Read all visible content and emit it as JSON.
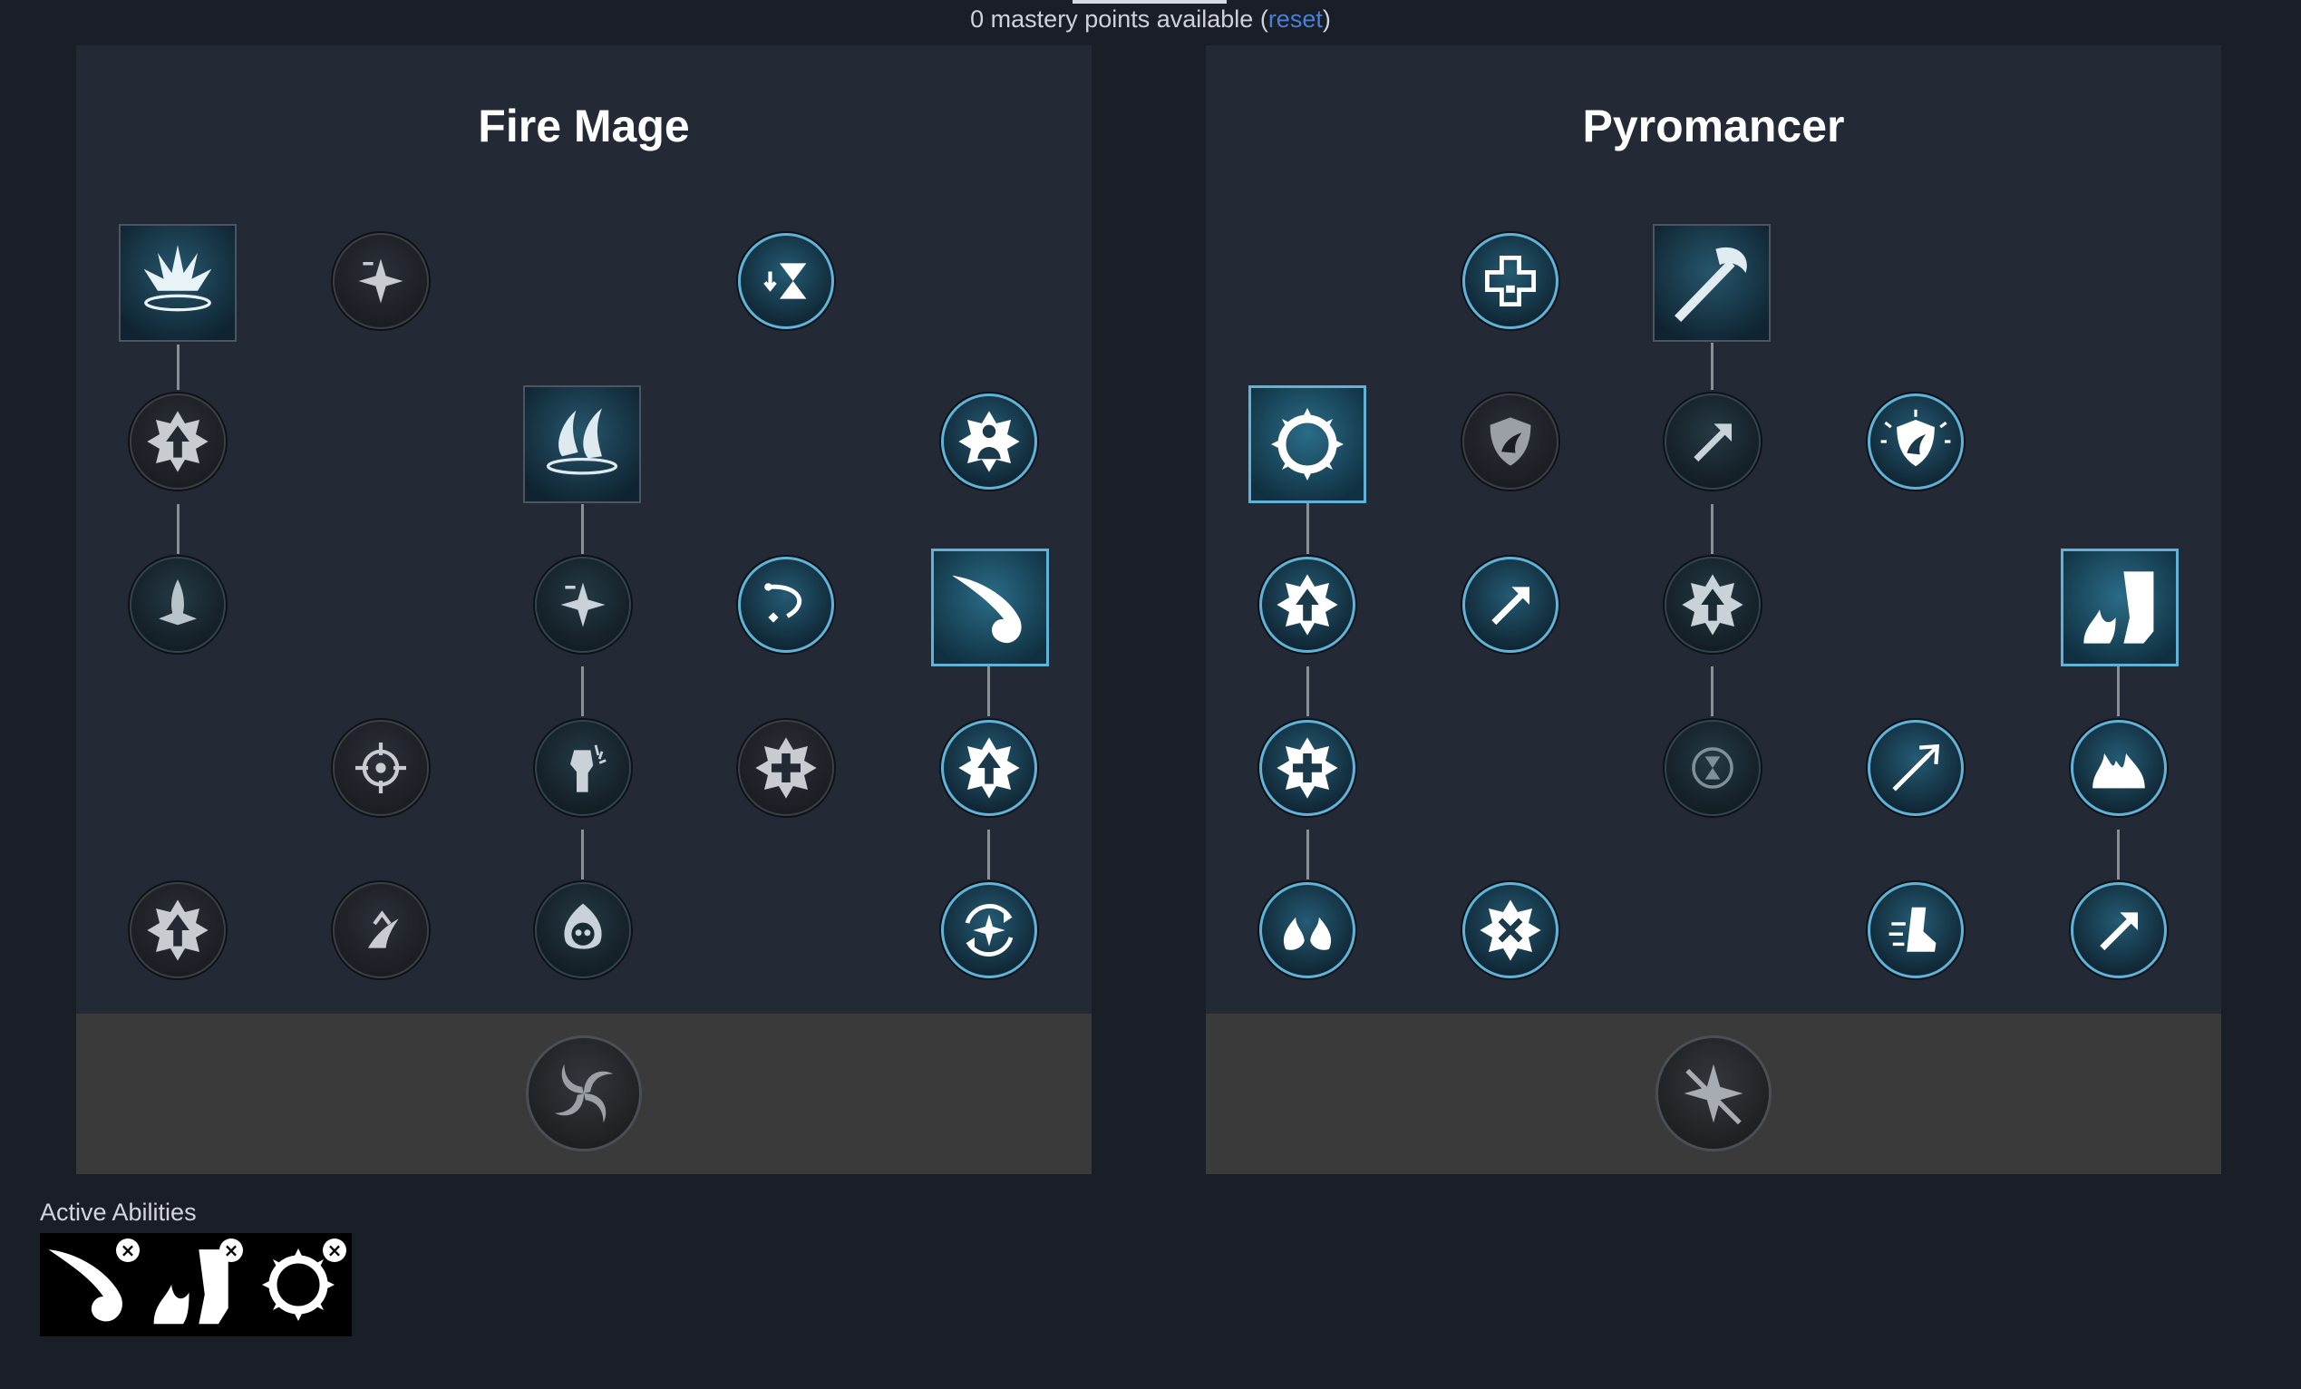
{
  "header": {
    "points_text": "0 mastery points available (",
    "reset_label": "reset",
    "points_close": ")"
  },
  "trees": {
    "left": {
      "title": "Fire Mage"
    },
    "right": {
      "title": "Pyromancer"
    }
  },
  "active_abilities": {
    "label": "Active Abilities",
    "remove_glyph": "×",
    "items": [
      {
        "icon": "meteor-icon"
      },
      {
        "icon": "flame-boot-icon"
      },
      {
        "icon": "fire-ring-icon"
      }
    ]
  },
  "colors": {
    "accent": "#5fb2d8",
    "link": "#4a7fd8",
    "panel": "#232a36",
    "background": "#1a1e26"
  }
}
